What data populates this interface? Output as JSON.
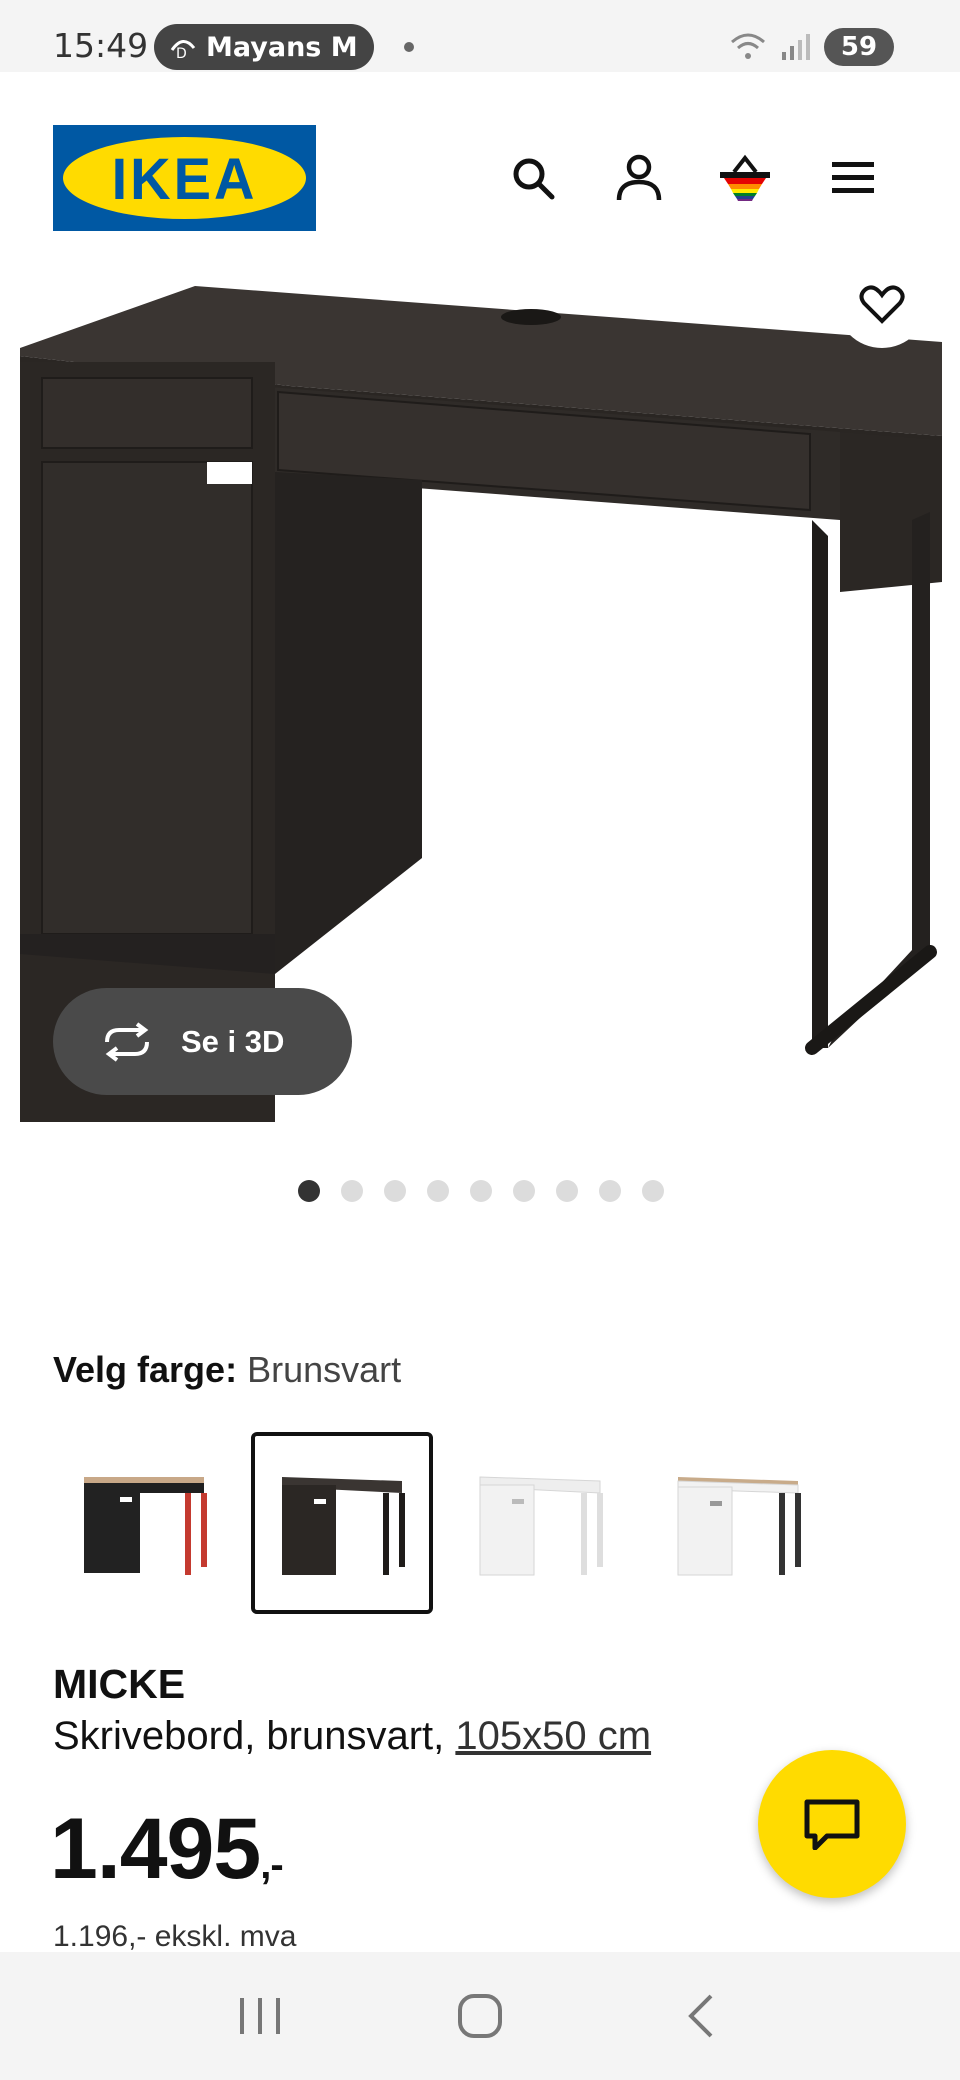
{
  "status_bar": {
    "time": "15:49",
    "notification_app": "Mayans M.C",
    "battery": "59"
  },
  "header": {
    "logo_text": "IKEA",
    "icons": [
      "search-icon",
      "account-icon",
      "cart-icon",
      "menu-icon"
    ]
  },
  "hero": {
    "view_3d_label": "Se i 3D",
    "image_count": 9,
    "active_image": 1
  },
  "color": {
    "label": "Velg farge:",
    "selected": "Brunsvart",
    "swatches": [
      "svart/rød",
      "brunsvart",
      "hvit",
      "hvit/eik"
    ]
  },
  "product": {
    "name": "MICKE",
    "description": "Skrivebord, brunsvart, ",
    "size": "105x50 cm",
    "price": "1.495",
    "price_suffix": ",-",
    "price_ex_vat": "1.196,- ekskl. mva"
  },
  "colors": {
    "ikea_blue": "#0058a3",
    "ikea_yellow": "#ffdb00",
    "desk": "#2b2724"
  }
}
